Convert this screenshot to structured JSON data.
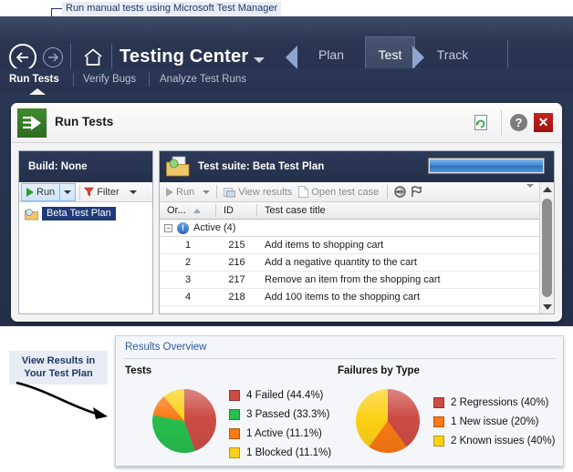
{
  "callouts": {
    "top": "Run manual tests using Microsoft Test Manager",
    "bottom": "View Results in Your Test Plan"
  },
  "navbar": {
    "app_title": "Testing Center",
    "back_icon": "back-arrow-icon",
    "forward_icon": "forward-arrow-icon",
    "home_icon": "home-icon",
    "title_caret_icon": "chevron-down-icon",
    "prev_phase_icon": "left-triangle-icon",
    "next_phase_icon": "right-triangle-icon",
    "phases": [
      {
        "label": "Plan",
        "active": false
      },
      {
        "label": "Test",
        "active": true
      },
      {
        "label": "Track",
        "active": false
      }
    ],
    "accent_color": "#e3b04b"
  },
  "subnav": {
    "items": [
      {
        "label": "Run Tests",
        "active": true
      },
      {
        "label": "Verify Bugs",
        "active": false
      },
      {
        "label": "Analyze Test Runs",
        "active": false
      }
    ]
  },
  "card": {
    "title": "Run Tests",
    "icon": "run-tests-icon",
    "refresh_icon": "refresh-page-icon",
    "help_label": "?",
    "close_label": "✕"
  },
  "left_pane": {
    "build_label": "Build: None",
    "run_label": "Run",
    "run_icon": "play-triangle-icon",
    "filter_label": "Filter",
    "filter_icon": "filter-funnel-icon",
    "tree_items": [
      {
        "label": "Beta Test Plan",
        "icon": "test-plan-icon",
        "selected": true
      }
    ]
  },
  "right_pane": {
    "suite_title": "Test suite: Beta Test Plan",
    "suite_icon": "test-suite-icon",
    "progress_percent": 100,
    "toolbar": [
      {
        "label": "Run",
        "icon": "play-triangle-icon",
        "has_caret": true
      },
      {
        "label": "View results",
        "icon": "view-results-icon",
        "has_caret": false
      },
      {
        "label": "Open test case",
        "icon": "open-test-case-icon",
        "has_caret": false
      }
    ],
    "toolbar_icons": [
      {
        "name": "block-icon"
      },
      {
        "name": "flag-icon"
      }
    ],
    "overflow_icon": "chevron-down-icon",
    "grid": {
      "columns": [
        "Or...",
        "ID",
        "Test case title"
      ],
      "sort_column": "Or...",
      "sort_direction": "asc",
      "group": {
        "label": "Active (4)",
        "icon": "info-icon",
        "expanded": true
      },
      "rows": [
        {
          "order": "1",
          "id": "215",
          "title": "Add items to shopping cart"
        },
        {
          "order": "2",
          "id": "216",
          "title": "Add a negative quantity to the cart"
        },
        {
          "order": "3",
          "id": "217",
          "title": "Remove an item from the shopping cart"
        },
        {
          "order": "4",
          "id": "218",
          "title": "Add 100 items to the shopping cart"
        }
      ]
    }
  },
  "results": {
    "title": "Results Overview",
    "tests_heading": "Tests",
    "failures_heading": "Failures by Type"
  },
  "chart_data": [
    {
      "type": "pie",
      "title": "Tests",
      "categories": [
        "Failed",
        "Passed",
        "Active",
        "Blocked"
      ],
      "counts": [
        4,
        3,
        1,
        1
      ],
      "values": [
        44.4,
        33.3,
        11.1,
        11.1
      ],
      "colors": [
        "#cc4c45",
        "#27bf4e",
        "#f97a16",
        "#fdd017"
      ],
      "labels": [
        "4 Failed (44.4%)",
        "3 Passed (33.3%)",
        "1 Active (11.1%)",
        "1 Blocked (11.1%)"
      ],
      "legend_position": "right",
      "total": 9
    },
    {
      "type": "pie",
      "title": "Failures by Type",
      "categories": [
        "Regressions",
        "New issue",
        "Known issues"
      ],
      "counts": [
        2,
        1,
        2
      ],
      "values": [
        40,
        20,
        40
      ],
      "colors": [
        "#cc4c45",
        "#f97a16",
        "#fdd017"
      ],
      "labels": [
        "2 Regressions (40%)",
        "1 New issue (20%)",
        "2 Known issues (40%)"
      ],
      "legend_position": "right",
      "total": 5
    }
  ]
}
